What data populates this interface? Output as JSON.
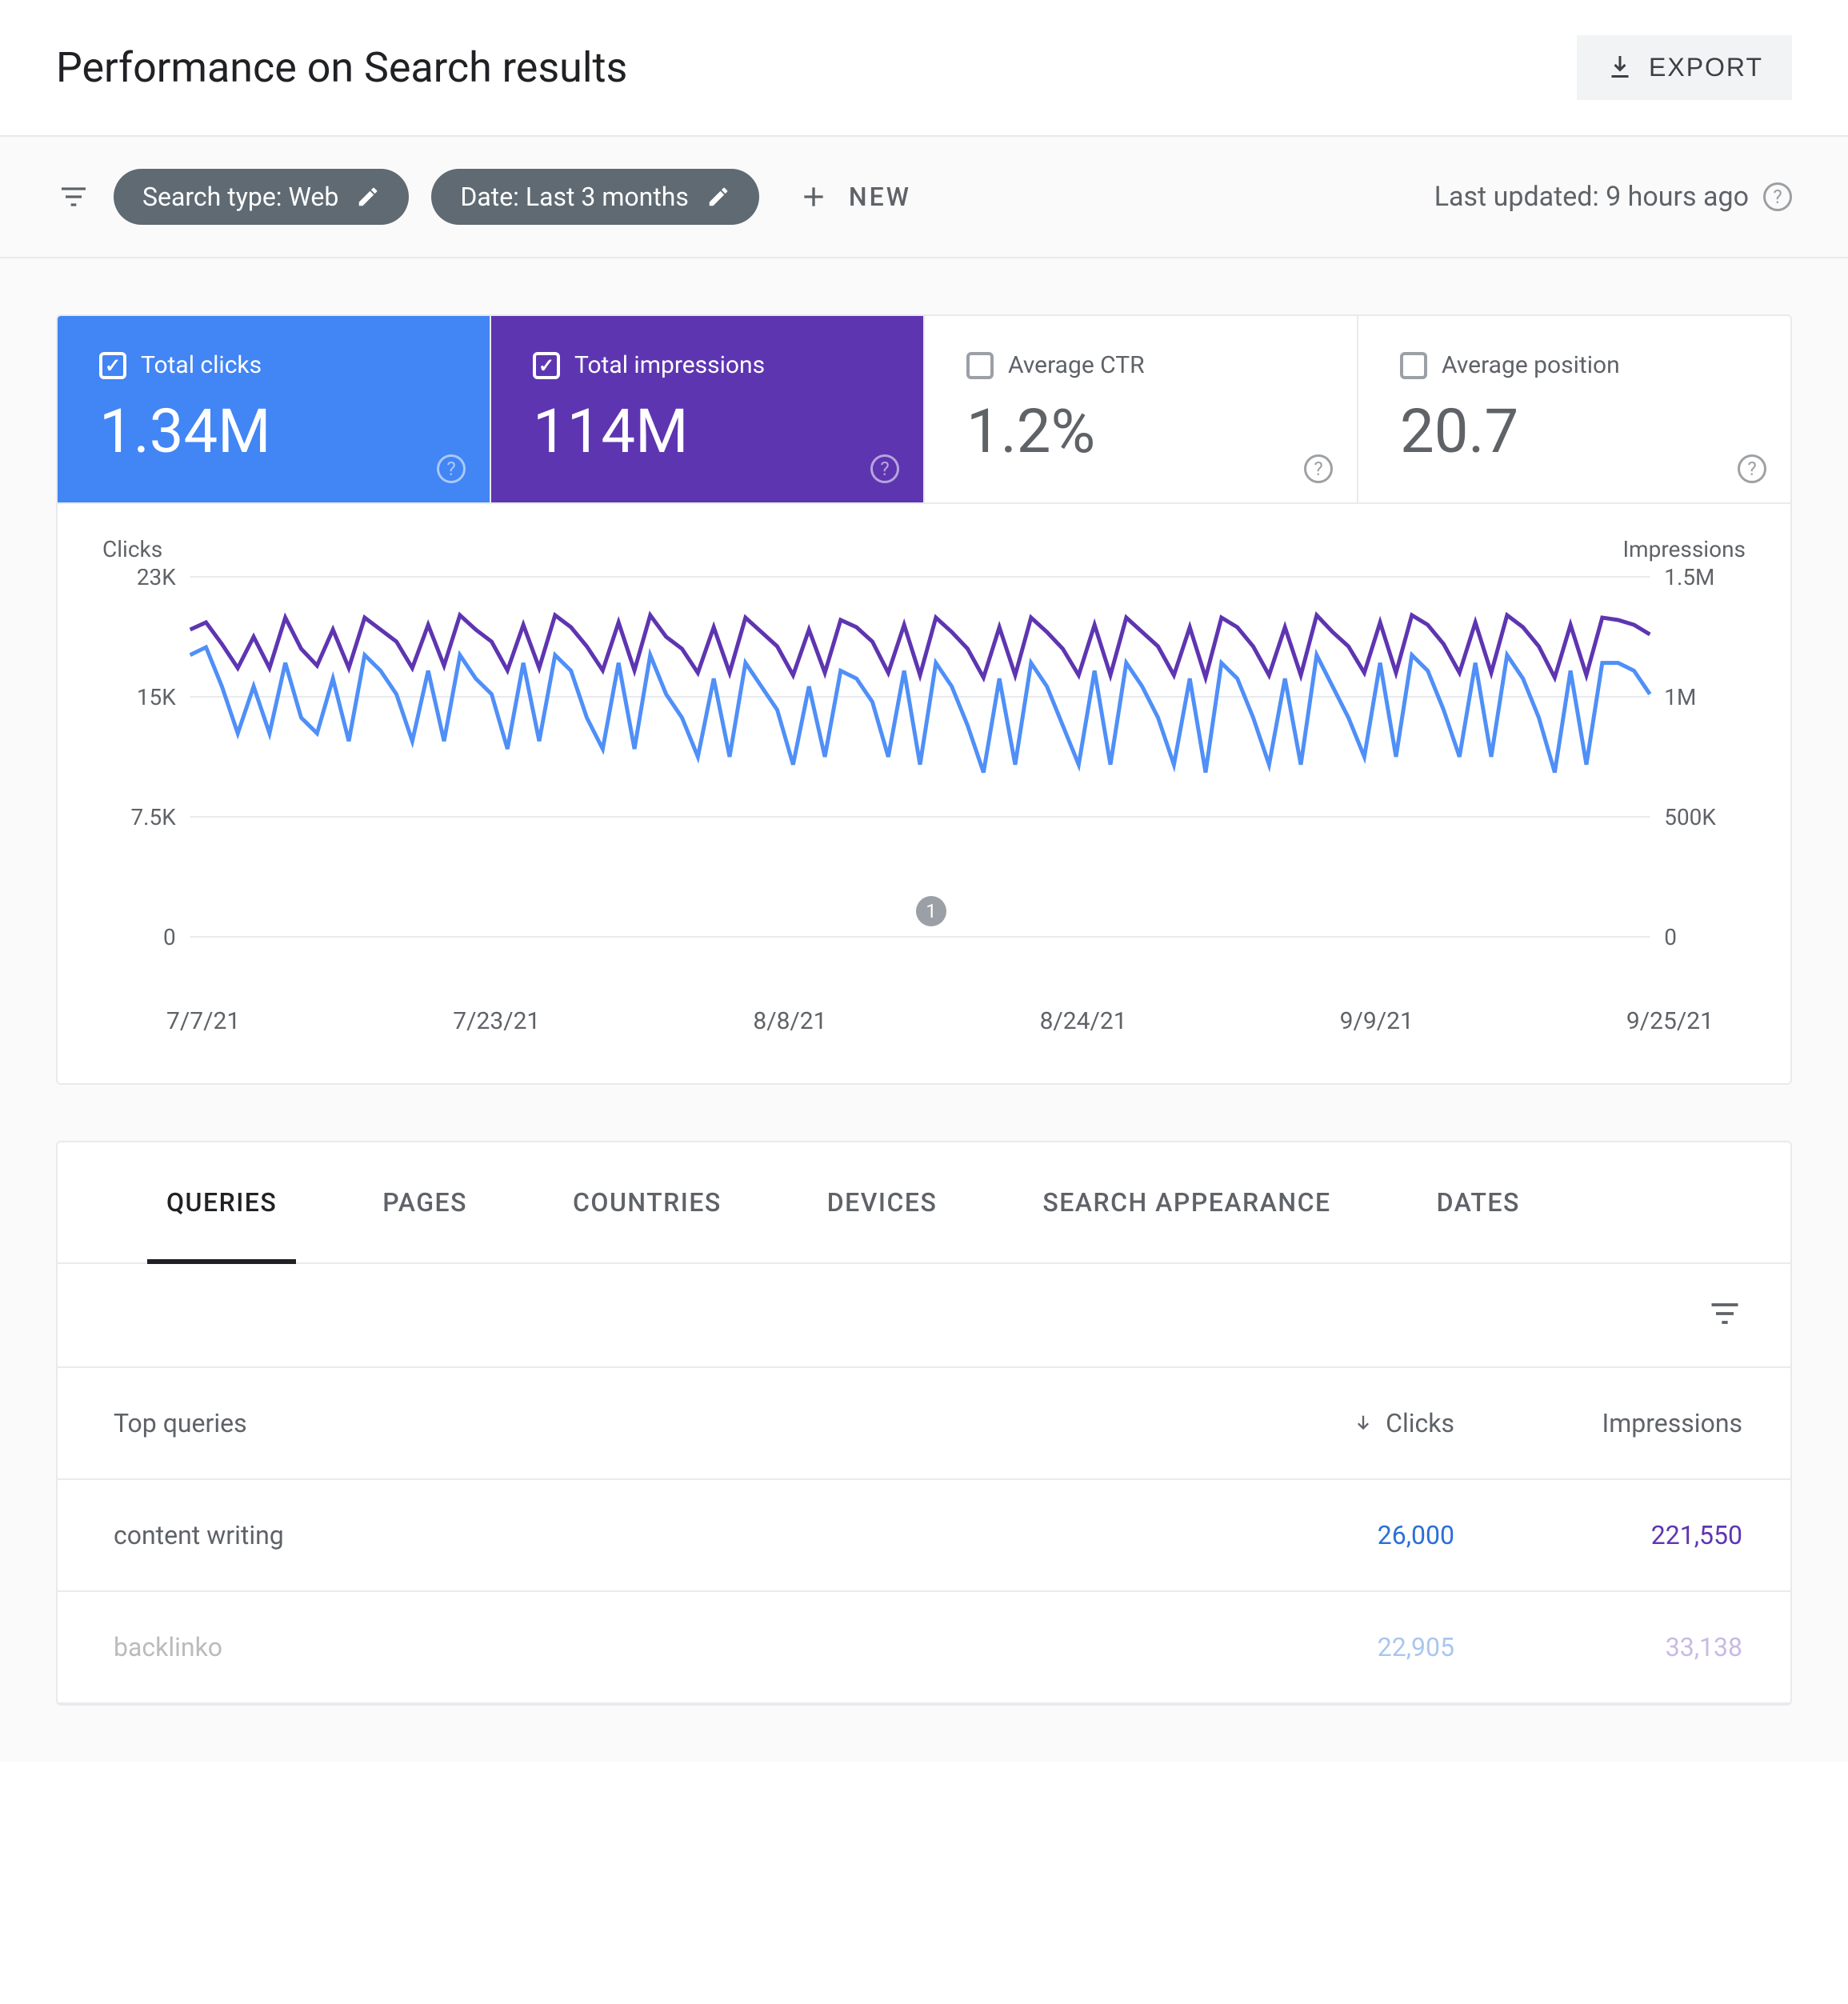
{
  "header": {
    "title": "Performance on Search results",
    "export_label": "EXPORT"
  },
  "filters": {
    "search_type_chip": "Search type: Web",
    "date_chip": "Date: Last 3 months",
    "new_label": "NEW",
    "last_updated": "Last updated: 9 hours ago"
  },
  "metrics": {
    "clicks": {
      "label": "Total clicks",
      "value": "1.34M",
      "checked": true,
      "color": "#4285f4"
    },
    "impressions": {
      "label": "Total impressions",
      "value": "114M",
      "checked": true,
      "color": "#5e35b1"
    },
    "ctr": {
      "label": "Average CTR",
      "value": "1.2%",
      "checked": false
    },
    "position": {
      "label": "Average position",
      "value": "20.7",
      "checked": false
    }
  },
  "chart_axes": {
    "left_title": "Clicks",
    "right_title": "Impressions",
    "y_left": [
      "23K",
      "15K",
      "7.5K",
      "0"
    ],
    "y_right": [
      "1.5M",
      "1M",
      "500K",
      "0"
    ],
    "x": [
      "7/7/21",
      "7/23/21",
      "8/8/21",
      "8/24/21",
      "9/9/21",
      "9/25/21"
    ],
    "footnote_badge": "1"
  },
  "chart_data": {
    "type": "line",
    "xlabel": "",
    "x_ticks": [
      "7/7/21",
      "7/23/21",
      "8/8/21",
      "8/24/21",
      "9/9/21",
      "9/25/21"
    ],
    "series": [
      {
        "name": "Clicks",
        "axis": "left",
        "ylabel": "Clicks",
        "ylim": [
          0,
          23000
        ],
        "color": "#4f8ff7",
        "values": [
          18000,
          18500,
          16000,
          13000,
          16000,
          13000,
          17500,
          14000,
          13000,
          16500,
          12500,
          18000,
          17000,
          15500,
          12500,
          17000,
          12500,
          18000,
          16500,
          15500,
          12000,
          17500,
          12500,
          18000,
          17000,
          14000,
          12000,
          17500,
          12000,
          18000,
          15500,
          14000,
          11500,
          16500,
          11500,
          17500,
          16000,
          14500,
          11000,
          16000,
          11500,
          17000,
          16500,
          15000,
          11500,
          17000,
          11000,
          17500,
          16000,
          13500,
          10500,
          16500,
          11000,
          17500,
          16000,
          13500,
          11000,
          17000,
          11000,
          17500,
          16000,
          14000,
          11000,
          16500,
          10500,
          17500,
          16500,
          14000,
          11000,
          16500,
          11000,
          18000,
          16000,
          14000,
          11500,
          17500,
          11500,
          18000,
          17000,
          14500,
          11500,
          17500,
          11500,
          18000,
          16500,
          14000,
          10500,
          17000,
          11000,
          17500,
          17500,
          17000,
          15500
        ]
      },
      {
        "name": "Impressions",
        "axis": "right",
        "ylabel": "Impressions",
        "ylim": [
          0,
          1500000
        ],
        "color": "#5e35b1",
        "values": [
          1280000,
          1310000,
          1220000,
          1120000,
          1250000,
          1120000,
          1330000,
          1200000,
          1130000,
          1280000,
          1120000,
          1330000,
          1280000,
          1230000,
          1120000,
          1300000,
          1130000,
          1340000,
          1280000,
          1230000,
          1110000,
          1300000,
          1120000,
          1340000,
          1290000,
          1210000,
          1110000,
          1310000,
          1110000,
          1340000,
          1250000,
          1200000,
          1100000,
          1290000,
          1100000,
          1330000,
          1270000,
          1210000,
          1090000,
          1280000,
          1100000,
          1320000,
          1290000,
          1230000,
          1100000,
          1300000,
          1090000,
          1330000,
          1270000,
          1200000,
          1080000,
          1290000,
          1090000,
          1330000,
          1270000,
          1200000,
          1090000,
          1300000,
          1090000,
          1330000,
          1270000,
          1210000,
          1090000,
          1290000,
          1080000,
          1330000,
          1290000,
          1210000,
          1090000,
          1290000,
          1090000,
          1340000,
          1270000,
          1210000,
          1100000,
          1310000,
          1100000,
          1340000,
          1300000,
          1220000,
          1100000,
          1310000,
          1100000,
          1340000,
          1290000,
          1210000,
          1080000,
          1300000,
          1090000,
          1330000,
          1320000,
          1300000,
          1260000
        ]
      }
    ]
  },
  "tabs": [
    "QUERIES",
    "PAGES",
    "COUNTRIES",
    "DEVICES",
    "SEARCH APPEARANCE",
    "DATES"
  ],
  "active_tab": 0,
  "table": {
    "head": {
      "queries": "Top queries",
      "clicks": "Clicks",
      "impressions": "Impressions"
    },
    "rows": [
      {
        "q": "content writing",
        "c": "26,000",
        "i": "221,550",
        "faded": false
      },
      {
        "q": "backlinko",
        "c": "22,905",
        "i": "33,138",
        "faded": true
      }
    ]
  }
}
